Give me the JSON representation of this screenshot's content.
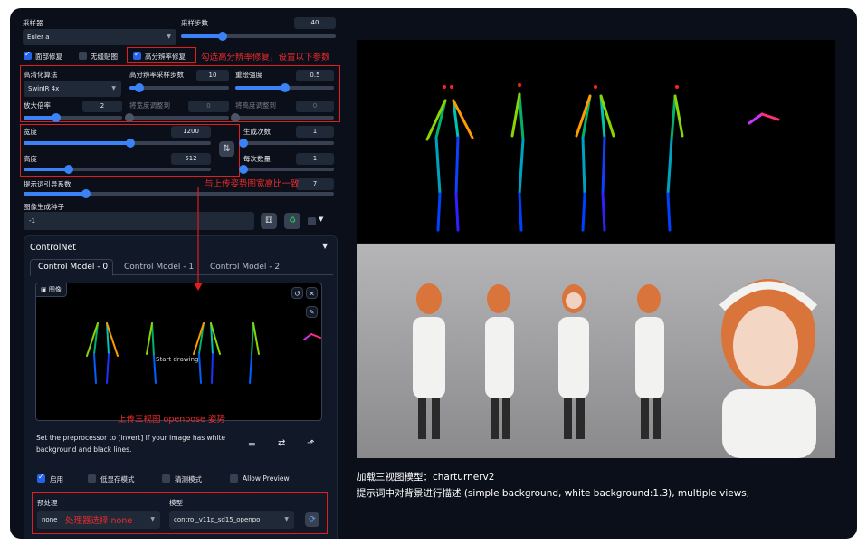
{
  "sampler": {
    "label": "采样器",
    "value": "Euler a"
  },
  "steps": {
    "label": "采样步数",
    "value": "40",
    "fraction": 0.27
  },
  "checks": {
    "restore_faces": "面部修复",
    "tiling": "无缝贴图",
    "hires_fix": "高分辨率修复"
  },
  "hires": {
    "upscaler_label": "高清化算法",
    "upscaler_value": "SwinIR 4x",
    "steps_label": "高分辨率采样步数",
    "steps_value": "10",
    "steps_fraction": 0.1,
    "denoise_label": "重绘强度",
    "denoise_value": "0.5",
    "denoise_fraction": 0.5,
    "scale_label": "放大倍率",
    "scale_value": "2",
    "scale_fraction": 0.33,
    "resize_w_label": "将宽度调整到",
    "resize_w_value": "0",
    "resize_h_label": "将高度调整到",
    "resize_h_value": "0"
  },
  "size": {
    "width_label": "宽度",
    "width_value": "1200",
    "width_fraction": 0.57,
    "height_label": "高度",
    "height_value": "512",
    "height_fraction": 0.24,
    "swap_icon": "swap-icon"
  },
  "batch": {
    "count_label": "生成次数",
    "count_value": "1",
    "size_label": "每次数量",
    "size_value": "1"
  },
  "cfg": {
    "label": "提示词引导系数",
    "value": "7",
    "fraction": 0.2
  },
  "seed": {
    "label": "图像生成种子",
    "value": "-1"
  },
  "controlnet": {
    "title": "ControlNet",
    "tabs": [
      "Control Model - 0",
      "Control Model - 1",
      "Control Model - 2"
    ],
    "image_label": "图像",
    "start_drawing": "Start drawing",
    "hint": "Set the preprocessor to [invert] If your image has white background and black lines.",
    "enable": "启用",
    "low_vram": "低显存模式",
    "guess_mode": "猜测模式",
    "allow_preview": "Allow Preview",
    "preprocessor_label": "预处理",
    "preprocessor_value": "none",
    "model_label": "模型",
    "model_value": "control_v11p_sd15_openpo"
  },
  "annotations": {
    "hires_note": "勾选高分辨率修复，设置以下参数",
    "ratio_note": "与上传姿势图宽高比一致",
    "upload_note": "上传三视图 openpose 姿势",
    "preprocessor_note": "处理器选择 none"
  },
  "captions": {
    "line1": "加载三视图模型：charturnerv2",
    "line2": "提示词中对背景进行描述 (simple background, white background:1.3), multiple views,"
  },
  "colors": {
    "accent": "#3b82f6",
    "annotation": "#e11d1d",
    "background": "#0b0f19"
  }
}
